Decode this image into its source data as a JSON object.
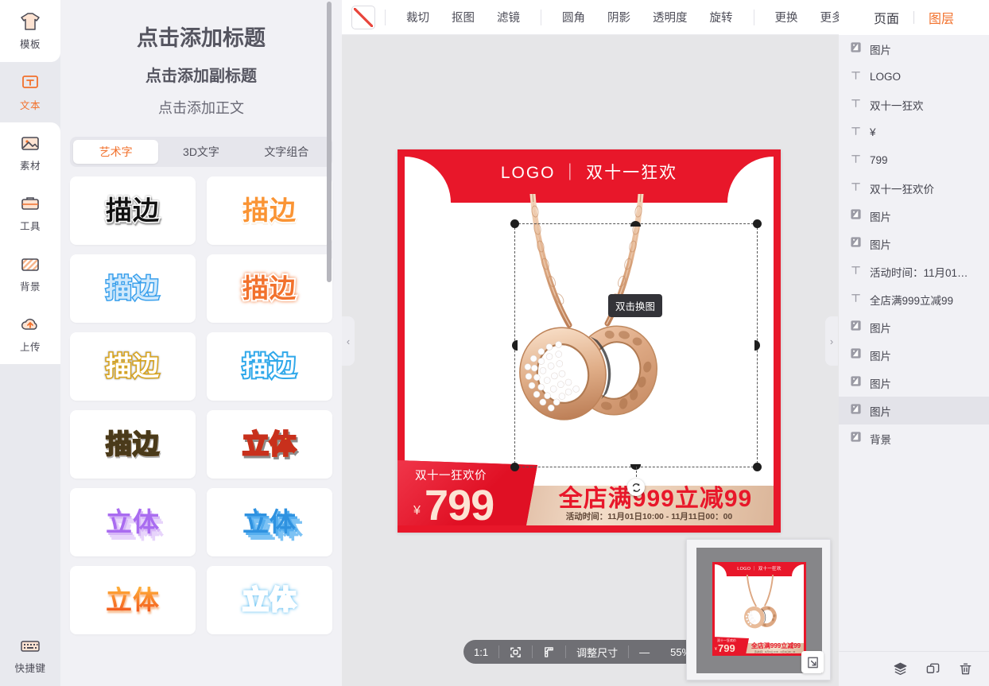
{
  "rail": {
    "items": [
      {
        "label": "模板",
        "icon": "template-icon",
        "active": false
      },
      {
        "label": "文本",
        "icon": "text-icon",
        "active": true
      },
      {
        "label": "素材",
        "icon": "material-icon",
        "active": false
      },
      {
        "label": "工具",
        "icon": "tools-icon",
        "active": false
      },
      {
        "label": "背景",
        "icon": "background-icon",
        "active": false
      },
      {
        "label": "上传",
        "icon": "upload-icon",
        "active": false
      }
    ],
    "bottom": {
      "label": "快捷键",
      "icon": "keyboard-icon"
    }
  },
  "panel": {
    "presets": {
      "title": "点击添加标题",
      "subtitle": "点击添加副标题",
      "body": "点击添加正文"
    },
    "tabs": [
      {
        "label": "艺术字",
        "active": true
      },
      {
        "label": "3D文字",
        "active": false
      },
      {
        "label": "文字组合",
        "active": false
      }
    ],
    "art_items": [
      {
        "text": "描边",
        "style": "outline-black"
      },
      {
        "text": "描边",
        "style": "orange-soft"
      },
      {
        "text": "描边",
        "style": "blue-hollow"
      },
      {
        "text": "描边",
        "style": "orange-stroke"
      },
      {
        "text": "描边",
        "style": "gold-hollow"
      },
      {
        "text": "描边",
        "style": "cyan-stroke"
      },
      {
        "text": "描边",
        "style": "orange-gradient-3d"
      },
      {
        "text": "立体",
        "style": "gold-3d"
      },
      {
        "text": "立体",
        "style": "purple-3d"
      },
      {
        "text": "立体",
        "style": "blue-3d"
      },
      {
        "text": "立体",
        "style": "orange-gradient"
      },
      {
        "text": "立体",
        "style": "cyan-gradient"
      }
    ]
  },
  "toolbar": {
    "color_swatch": "no-fill",
    "items": [
      "裁切",
      "抠图",
      "滤镜",
      "圆角",
      "阴影",
      "透明度",
      "旋转",
      "更换",
      "更多"
    ]
  },
  "handles": {
    "left": "‹",
    "right": "›"
  },
  "canvas": {
    "poster": {
      "header_text": "LOGO ｜ 双十一狂欢",
      "ribbon_label": "双十一狂欢价",
      "currency": "¥",
      "price": "799",
      "promo_main": "全店满999立减99",
      "promo_sub": "活动时间：11月01日10:00 - 11月11日00：00"
    },
    "tooltip": "双击换图",
    "rotate_icon": "rotate-icon"
  },
  "zoombar": {
    "ratio": "1:1",
    "fit_icon": "fit-screen-icon",
    "ruler_icon": "ruler-icon",
    "resize_label": "调整尺寸",
    "minus": "—",
    "zoom_level": "55%"
  },
  "thumbnail": {
    "header_text": "LOGO ｜ 双十一狂欢",
    "ribbon_label": "双十一狂欢价",
    "currency": "¥",
    "price": "799",
    "promo_main": "全店满999立减99",
    "promo_sub": "活动时间：11月01日10:00 - 11月11日00：00",
    "expand_icon": "expand-icon"
  },
  "right_panel": {
    "tabs": [
      {
        "label": "页面",
        "active": false
      },
      {
        "label": "图层",
        "active": true
      }
    ],
    "layers": [
      {
        "label": "图片",
        "type": "image",
        "selected": false
      },
      {
        "label": "LOGO",
        "type": "text",
        "selected": false
      },
      {
        "label": "双十一狂欢",
        "type": "text",
        "selected": false
      },
      {
        "label": "¥",
        "type": "text",
        "selected": false
      },
      {
        "label": "799",
        "type": "text",
        "selected": false
      },
      {
        "label": "双十一狂欢价",
        "type": "text",
        "selected": false
      },
      {
        "label": "图片",
        "type": "image",
        "selected": false
      },
      {
        "label": "图片",
        "type": "image",
        "selected": false
      },
      {
        "label": "活动时间：11月01日…",
        "type": "text",
        "selected": false
      },
      {
        "label": "全店满999立减99",
        "type": "text",
        "selected": false
      },
      {
        "label": "图片",
        "type": "image",
        "selected": false
      },
      {
        "label": "图片",
        "type": "image",
        "selected": false
      },
      {
        "label": "图片",
        "type": "image",
        "selected": false
      },
      {
        "label": "图片",
        "type": "image",
        "selected": true
      },
      {
        "label": "背景",
        "type": "image",
        "selected": false
      }
    ],
    "footer_icons": [
      "layers-icon",
      "duplicate-icon",
      "delete-icon"
    ]
  },
  "colors": {
    "accent": "#f2712c",
    "poster_red": "#e8172a",
    "panel_bg": "#f1f1f5",
    "stage_bg": "#e6e6e8"
  }
}
